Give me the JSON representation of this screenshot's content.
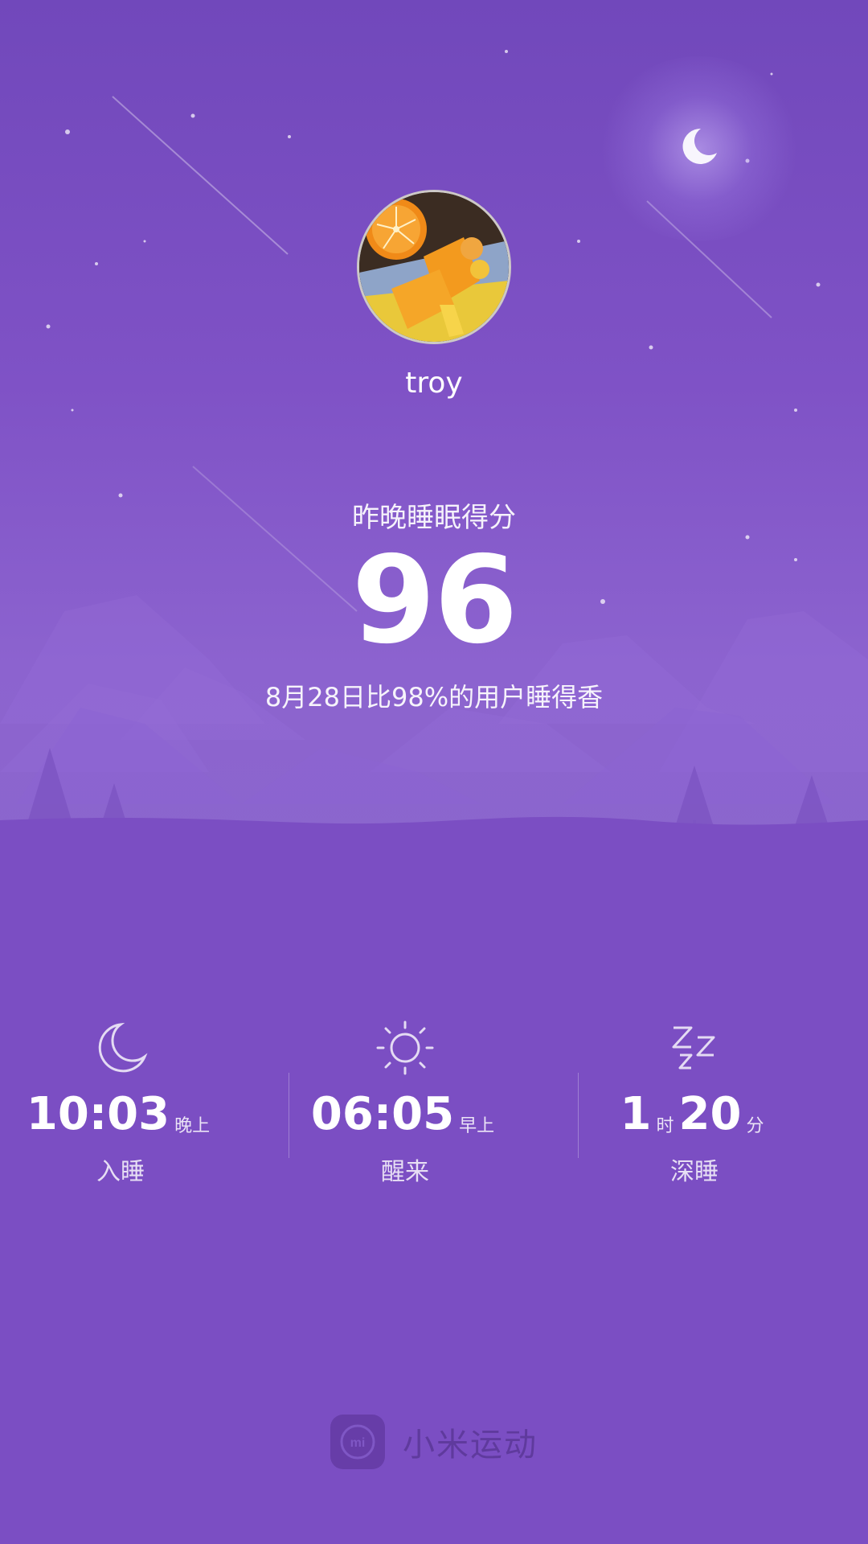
{
  "profile": {
    "username": "troy"
  },
  "sleep_score": {
    "label": "昨晚睡眠得分",
    "value": "96",
    "description": "8月28日比98%的用户睡得香"
  },
  "stats": [
    {
      "icon": "moon-icon",
      "value": "10:03",
      "unit": "晚上",
      "label": "入睡"
    },
    {
      "icon": "sun-icon",
      "value": "06:05",
      "unit": "早上",
      "label": "醒来"
    },
    {
      "icon": "zzz-icon",
      "hours": "1",
      "hours_unit": "时",
      "minutes": "20",
      "minutes_unit": "分",
      "label": "深睡"
    }
  ],
  "footer": {
    "app_name": "小米运动",
    "logo_text": "mi"
  },
  "colors": {
    "background": "#7b4ec3",
    "sky_top": "#7148bb",
    "text": "#ffffff"
  }
}
